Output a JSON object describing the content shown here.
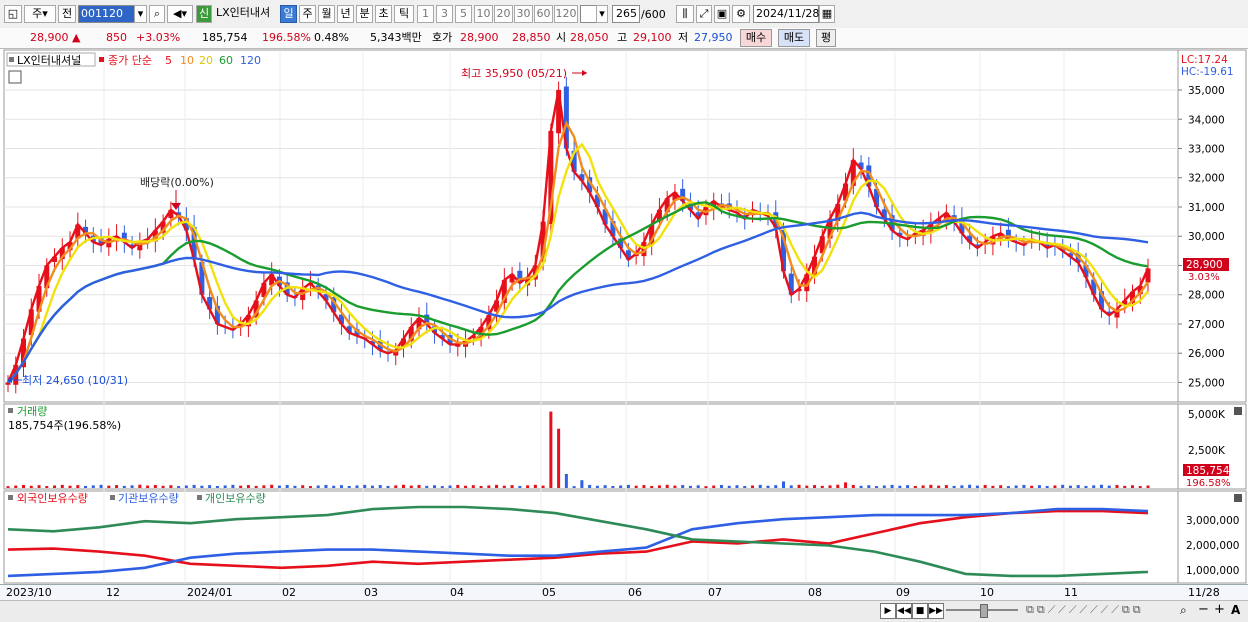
{
  "toolbar": {
    "period_select": "주",
    "prev_label": "전",
    "stock_code": "001120",
    "new_label": "신",
    "stock_name": "LX인터내셔",
    "periods": [
      "일",
      "주",
      "월",
      "년",
      "분",
      "초",
      "틱"
    ],
    "selected_period": "일",
    "intervals": [
      "1",
      "3",
      "5",
      "10",
      "20",
      "30",
      "60",
      "120"
    ],
    "count_value": "265",
    "count_total": "/600",
    "date": "2024/11/28"
  },
  "info": {
    "price": "28,900",
    "change": "850",
    "change_pct": "+3.03%",
    "volume": "185,754",
    "volume_ratio": "196.58%",
    "turnover": "0.48%",
    "amount": "5,343백만",
    "quote_label": "호가",
    "ask": "28,900",
    "bid": "28,850",
    "open_label": "시",
    "open": "28,050",
    "high_label": "고",
    "high": "29,100",
    "low_label": "저",
    "low": "27,950",
    "buy_label": "매수",
    "sell_label": "매도",
    "avg_label": "평"
  },
  "price_panel": {
    "stock_label": "LX인터내셔널",
    "ma_label": "종가 단순",
    "ma_periods": [
      "5",
      "10",
      "20",
      "60",
      "120"
    ],
    "ma_colors": [
      "#e5101b",
      "#f28c1d",
      "#f2e20c",
      "#1a9d2e",
      "#2f5fe3"
    ],
    "lc": "LC:17.24",
    "hc": "HC:-19.61",
    "high_annotation": "최고 35,950 (05/21)",
    "low_annotation": "최저 24,650 (10/31)",
    "dividend_annotation": "배당락(0.00%)",
    "y_ticks": [
      "35,000",
      "34,000",
      "33,000",
      "32,000",
      "31,000",
      "30,000",
      "29,000",
      "28,000",
      "27,000",
      "26,000",
      "25,000"
    ],
    "current_price_tag": "28,900",
    "current_pct_tag": "3.03%"
  },
  "volume_panel": {
    "title": "거래량",
    "value_label": "185,754주(196.58%)",
    "y_ticks": [
      "5,000K",
      "2,500K"
    ],
    "tag_value": "185,754",
    "tag_pct": "196.58%"
  },
  "holdings_panel": {
    "labels": [
      "외국인보유수량",
      "기관보유수량",
      "개인보유수량"
    ],
    "colors": [
      "#e5101b",
      "#2f5fe3",
      "#2e8b57"
    ],
    "y_ticks": [
      "3,000,000",
      "2,000,000",
      "1,000,000"
    ]
  },
  "x_axis": {
    "labels": [
      "2023/10",
      "12",
      "2024/01",
      "02",
      "03",
      "04",
      "05",
      "06",
      "07",
      "08",
      "09",
      "10",
      "11",
      "11/28"
    ]
  },
  "chart_data": [
    {
      "type": "candlestick",
      "title": "LX인터내셔널",
      "x_start": "2023/10",
      "x_end": "2024/11/28",
      "ylim": [
        24400,
        36300
      ],
      "close": [
        25000,
        25600,
        26500,
        27500,
        28300,
        29000,
        29300,
        29600,
        29800,
        30400,
        30100,
        29800,
        29700,
        29900,
        30000,
        29800,
        29600,
        29800,
        29900,
        30200,
        30500,
        30900,
        30700,
        30200,
        29200,
        28000,
        27500,
        27000,
        26900,
        26800,
        27000,
        27300,
        27800,
        28400,
        28700,
        28300,
        28000,
        27900,
        28200,
        28400,
        28100,
        27800,
        27400,
        27000,
        26700,
        26600,
        26500,
        26300,
        26100,
        26000,
        26100,
        26500,
        26900,
        27200,
        27000,
        26700,
        26500,
        26300,
        26300,
        26400,
        26600,
        26900,
        27300,
        27800,
        28500,
        28700,
        28400,
        28600,
        29000,
        30500,
        33600,
        35000,
        33000,
        32200,
        31900,
        31500,
        31000,
        30400,
        30000,
        29600,
        29200,
        29400,
        29800,
        30400,
        30900,
        31300,
        31500,
        31200,
        30900,
        30600,
        31000,
        31200,
        31000,
        30900,
        30800,
        30600,
        30900,
        30800,
        30700,
        30300,
        28800,
        28000,
        28200,
        28700,
        29300,
        30000,
        30600,
        31100,
        31800,
        32600,
        32300,
        31700,
        31000,
        30600,
        30200,
        30000,
        29900,
        30100,
        30200,
        30400,
        30600,
        30800,
        30500,
        30100,
        29800,
        29600,
        29800,
        30000,
        30100,
        29900,
        29800,
        29700,
        29900,
        29800,
        29600,
        29700,
        29500,
        29300,
        29100,
        28600,
        28000,
        27500,
        27300,
        27500,
        27800,
        28100,
        28300,
        28900
      ],
      "ma_periods": [
        5,
        10,
        20,
        60,
        120
      ]
    },
    {
      "type": "bar",
      "title": "거래량",
      "unit": "K",
      "peak": 5000,
      "last": 185.754
    },
    {
      "type": "line",
      "series": [
        {
          "name": "외국인보유수량",
          "values": [
            1600000,
            1650000,
            1500000,
            1300000,
            900000,
            800000,
            700000,
            800000,
            1000000,
            900000,
            1000000,
            1100000,
            1200000,
            1400000,
            1500000,
            2000000,
            1900000,
            2100000,
            1900000,
            2400000,
            2900000,
            3200000,
            3400000,
            3500000,
            3500000,
            3400000
          ]
        },
        {
          "name": "기관보유수량",
          "values": [
            300000,
            400000,
            500000,
            700000,
            1200000,
            1400000,
            1500000,
            1600000,
            1600000,
            1500000,
            1400000,
            1300000,
            1300000,
            1500000,
            1700000,
            2600000,
            2900000,
            3100000,
            3200000,
            3300000,
            3300000,
            3300000,
            3400000,
            3600000,
            3600000,
            3500000
          ]
        },
        {
          "name": "개인보유수량",
          "values": [
            2600000,
            2500000,
            2700000,
            3000000,
            2900000,
            3100000,
            3200000,
            3300000,
            3600000,
            3700000,
            3700000,
            3600000,
            3400000,
            3000000,
            2600000,
            2100000,
            2000000,
            1900000,
            1800000,
            1500000,
            1000000,
            400000,
            300000,
            300000,
            400000,
            500000
          ]
        }
      ],
      "ylim": [
        0,
        3800000
      ]
    }
  ],
  "bottom": {
    "icons": [
      "scroll-right-icon",
      "rewind-icon",
      "stop-icon",
      "forward-icon",
      "zoom-slider",
      "draw-tools-icon",
      "search-icon",
      "zoom-out-icon",
      "zoom-in-icon",
      "text-icon"
    ]
  }
}
